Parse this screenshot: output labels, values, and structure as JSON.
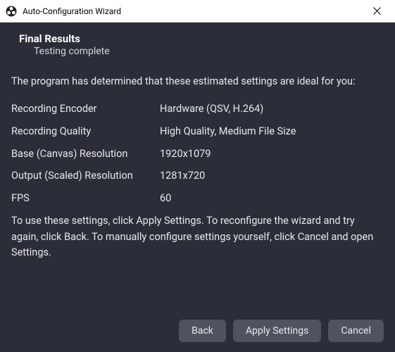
{
  "window": {
    "title": "Auto-Configuration Wizard"
  },
  "header": {
    "title": "Final Results",
    "subtitle": "Testing complete"
  },
  "body": {
    "intro": "The program has determined that these estimated settings are ideal for you:",
    "settings": [
      {
        "label": "Recording Encoder",
        "value": "Hardware (QSV, H.264)"
      },
      {
        "label": "Recording Quality",
        "value": "High Quality, Medium File Size"
      },
      {
        "label": "Base (Canvas) Resolution",
        "value": "1920x1079"
      },
      {
        "label": "Output (Scaled) Resolution",
        "value": "1281x720"
      },
      {
        "label": "FPS",
        "value": "60"
      }
    ],
    "footer": "To use these settings, click Apply Settings. To reconfigure the wizard and try again, click Back. To manually configure settings yourself, click Cancel and open Settings."
  },
  "buttons": {
    "back": "Back",
    "apply": "Apply Settings",
    "cancel": "Cancel"
  }
}
